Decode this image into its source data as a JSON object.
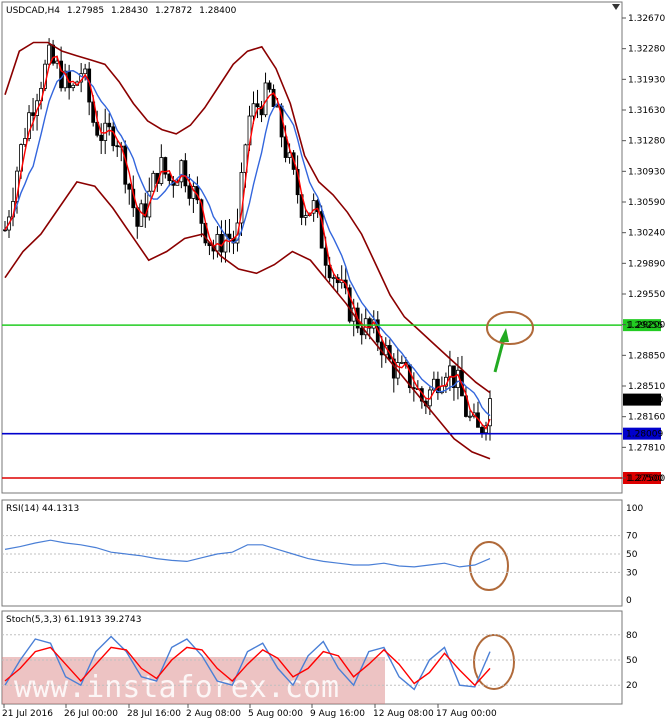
{
  "header": {
    "symbol": "USDCAD,H4",
    "open": "1.27985",
    "high": "1.28430",
    "low": "1.27872",
    "close": "1.28400"
  },
  "price_axis": {
    "ticks": [
      "1.32670",
      "1.32280",
      "1.31930",
      "1.31630",
      "1.31280",
      "1.30930",
      "1.30590",
      "1.30240",
      "1.29890",
      "1.29550",
      "1.29200",
      "1.28850",
      "1.28510",
      "1.28160",
      "1.27810",
      "1.27500"
    ]
  },
  "levels": [
    {
      "name": "resistance",
      "label": "1.29255",
      "value": 1.29255,
      "color": "#22cc22"
    },
    {
      "name": "current",
      "label": "1.28400",
      "value": 1.284,
      "color": "#000000"
    },
    {
      "name": "support",
      "label": "1.28009",
      "value": 1.28009,
      "color": "#0000cc"
    },
    {
      "name": "low",
      "label": "1.27500",
      "value": 1.275,
      "color": "#dd0000"
    }
  ],
  "rsi": {
    "label": "RSI(14) 44.1313",
    "ticks": [
      "100",
      "70",
      "50",
      "30",
      "0"
    ]
  },
  "stoch": {
    "label": "Stoch(5,3,3) 61.1913 39.2743",
    "ticks": [
      "80",
      "50",
      "20"
    ]
  },
  "time_axis": {
    "labels": [
      "21 Jul 2016",
      "26 Jul 00:00",
      "28 Jul 16:00",
      "2 Aug 08:00",
      "5 Aug 00:00",
      "9 Aug 16:00",
      "12 Aug 08:00",
      "17 Aug 00:00"
    ]
  },
  "watermark": "www.instaforex.com",
  "colors": {
    "bollinger": "#8b0000",
    "ma_fast": "#ff0000",
    "ma_slow": "#3366dd",
    "arrow": "#22aa22",
    "ellipse": "#b06a3a",
    "rsi_line": "#4a7fd6",
    "stoch_main": "#4a7fd6",
    "stoch_signal": "#ff0000"
  },
  "chart_data": {
    "type": "line",
    "title": "USDCAD,H4",
    "y_range": [
      1.275,
      1.3285
    ],
    "price_series": [
      {
        "name": "close",
        "values": [
          1.3035,
          1.31,
          1.316,
          1.32,
          1.323,
          1.3215,
          1.319,
          1.322,
          1.316,
          1.314,
          1.315,
          1.31,
          1.304,
          1.307,
          1.311,
          1.309,
          1.311,
          1.308,
          1.304,
          1.301,
          1.303,
          1.302,
          1.316,
          1.318,
          1.319,
          1.315,
          1.31,
          1.306,
          1.306,
          1.301,
          1.298,
          1.295,
          1.293,
          1.292,
          1.291,
          1.288,
          1.287,
          1.286,
          1.2835,
          1.286,
          1.288,
          1.286,
          1.282,
          1.28,
          1.284
        ]
      },
      {
        "name": "upper_band",
        "values": [
          1.319,
          1.324,
          1.325,
          1.325,
          1.324,
          1.3235,
          1.323,
          1.3225,
          1.3205,
          1.318,
          1.316,
          1.315,
          1.3145,
          1.3155,
          1.3175,
          1.32,
          1.3225,
          1.324,
          1.3245,
          1.322,
          1.318,
          1.312,
          1.309,
          1.3075,
          1.3055,
          1.303,
          1.2995,
          1.296,
          1.2935,
          1.292,
          1.2905,
          1.289,
          1.2875,
          1.286,
          1.2848
        ]
      },
      {
        "name": "lower_band",
        "values": [
          1.298,
          1.301,
          1.303,
          1.306,
          1.309,
          1.3085,
          1.306,
          1.303,
          1.3,
          1.301,
          1.3025,
          1.303,
          1.3005,
          1.299,
          1.2985,
          1.2995,
          1.301,
          1.3,
          1.2975,
          1.295,
          1.292,
          1.2895,
          1.287,
          1.2845,
          1.282,
          1.2795,
          1.278,
          1.2772
        ]
      }
    ],
    "rsi_values": [
      55,
      58,
      62,
      65,
      62,
      60,
      57,
      52,
      50,
      48,
      45,
      43,
      42,
      46,
      50,
      52,
      60,
      60,
      55,
      50,
      45,
      42,
      40,
      38,
      38,
      40,
      37,
      36,
      38,
      40,
      36,
      38,
      45
    ],
    "stoch_main": [
      20,
      50,
      75,
      70,
      30,
      20,
      60,
      78,
      60,
      30,
      25,
      65,
      75,
      55,
      25,
      20,
      60,
      70,
      40,
      20,
      55,
      72,
      40,
      20,
      60,
      65,
      30,
      15,
      50,
      65,
      20,
      18,
      60
    ],
    "stoch_signal": [
      25,
      40,
      60,
      65,
      45,
      25,
      45,
      65,
      62,
      40,
      28,
      50,
      65,
      62,
      40,
      25,
      45,
      62,
      52,
      30,
      40,
      60,
      55,
      30,
      45,
      62,
      45,
      22,
      35,
      58,
      38,
      20,
      40
    ]
  }
}
